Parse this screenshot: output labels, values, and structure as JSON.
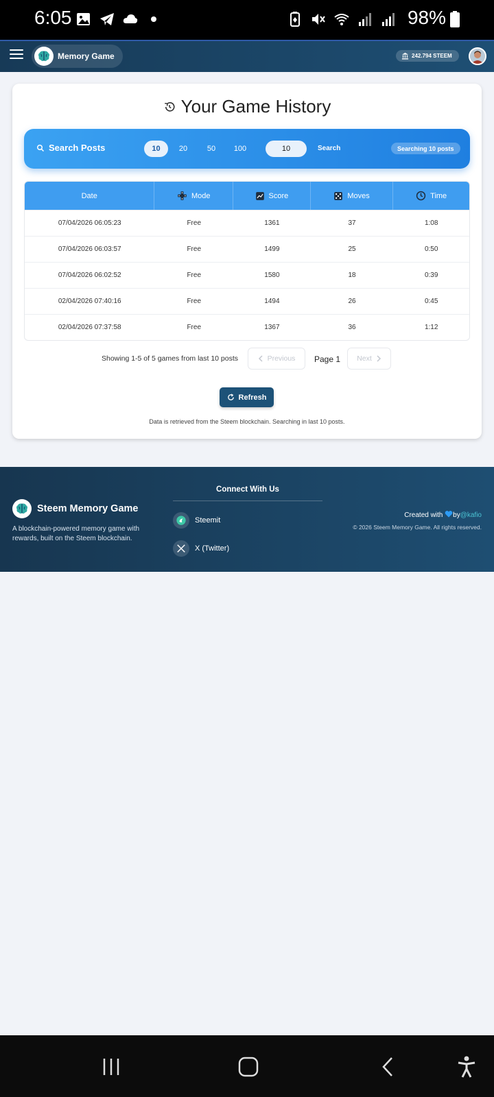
{
  "status_bar": {
    "time": "6:05",
    "battery_percent": "98%",
    "left_icons": [
      "gallery-icon",
      "telegram-icon",
      "cloud-icon",
      "dot-icon"
    ],
    "right_icons": [
      "battery-saver-icon",
      "mute-icon",
      "wifi-icon",
      "signal-icon",
      "signal-icon"
    ]
  },
  "header": {
    "app_name": "Memory Game",
    "balance": "242.794 STEEM"
  },
  "page": {
    "title": "Your Game History"
  },
  "search": {
    "label": "Search Posts",
    "options": [
      "10",
      "20",
      "50",
      "100"
    ],
    "selected_option": "10",
    "input_value": "10",
    "button_label": "Search",
    "status": "Searching 10 posts"
  },
  "table": {
    "columns": [
      "Date",
      "Mode",
      "Score",
      "Moves",
      "Time"
    ],
    "rows": [
      [
        "07/04/2026 06:05:23",
        "Free",
        "1361",
        "37",
        "1:08"
      ],
      [
        "07/04/2026 06:03:57",
        "Free",
        "1499",
        "25",
        "0:50"
      ],
      [
        "07/04/2026 06:02:52",
        "Free",
        "1580",
        "18",
        "0:39"
      ],
      [
        "02/04/2026 07:40:16",
        "Free",
        "1494",
        "26",
        "0:45"
      ],
      [
        "02/04/2026 07:37:58",
        "Free",
        "1367",
        "36",
        "1:12"
      ]
    ]
  },
  "pagination": {
    "info": "Showing 1-5 of 5 games from last 10 posts",
    "prev_label": "Previous",
    "page_label": "Page 1",
    "next_label": "Next"
  },
  "refresh_label": "Refresh",
  "note": "Data is retrieved from the Steem blockchain. Searching in last 10 posts.",
  "footer": {
    "brand": "Steem Memory Game",
    "description": "A blockchain-powered memory game with rewards, built on the Steem blockchain.",
    "connect_title": "Connect With Us",
    "links": [
      "Steemit",
      "X (Twitter)"
    ],
    "created_prefix": "Created with",
    "created_by": "by",
    "handle": "@kafio",
    "copyright": "© 2026 Steem Memory Game. All rights reserved."
  },
  "colors": {
    "header_bg": "#173a57",
    "search_bar": "#2b8ee8",
    "table_header": "#3f9df0",
    "refresh_button": "#1d5278",
    "footer_bg": "#173650",
    "handle_color": "#4cc4d4"
  }
}
